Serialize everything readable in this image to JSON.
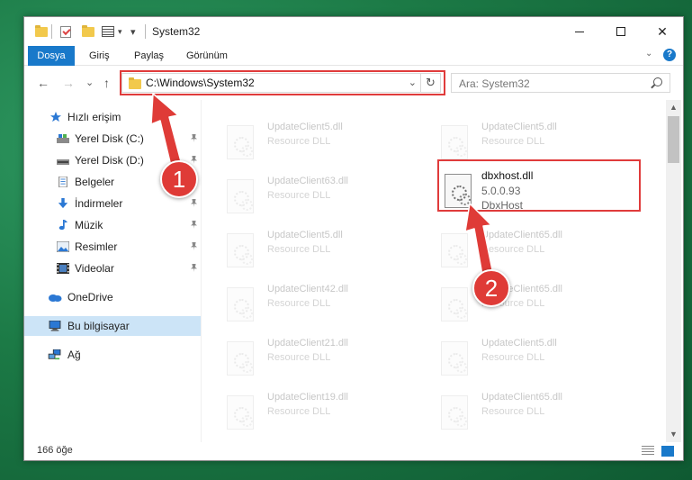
{
  "window": {
    "title": "System32"
  },
  "ribbon": {
    "tabs": [
      "Dosya",
      "Giriş",
      "Paylaş",
      "Görünüm"
    ],
    "active_tab": "Dosya",
    "expand": "⌄",
    "help": "?"
  },
  "nav": {
    "back": "←",
    "forward": "→",
    "recent": "⌄",
    "up": "↑"
  },
  "address": {
    "path": "C:\\Windows\\System32",
    "chevron": "⌄",
    "refresh": "↻"
  },
  "search": {
    "placeholder": "Ara: System32"
  },
  "sidebar": {
    "items": [
      {
        "label": "Hızlı erişim",
        "icon": "star-icon"
      },
      {
        "label": "Yerel Disk (C:)",
        "icon": "drive-c-icon",
        "pinned": true
      },
      {
        "label": "Yerel Disk (D:)",
        "icon": "drive-d-icon",
        "pinned": true
      },
      {
        "label": "Belgeler",
        "icon": "documents-icon",
        "pinned": true
      },
      {
        "label": "İndirmeler",
        "icon": "download-icon",
        "pinned": true
      },
      {
        "label": "Müzik",
        "icon": "music-icon",
        "pinned": true
      },
      {
        "label": "Resimler",
        "icon": "pictures-icon",
        "pinned": true
      },
      {
        "label": "Videolar",
        "icon": "videos-icon",
        "pinned": true
      },
      {
        "label": "OneDrive",
        "icon": "cloud-icon"
      },
      {
        "label": "Bu bilgisayar",
        "icon": "computer-icon",
        "selected": true
      },
      {
        "label": "Ağ",
        "icon": "network-icon"
      }
    ]
  },
  "files": [
    {
      "name": "UpdateClient5.dll",
      "desc": "Resource DLL"
    },
    {
      "name": "UpdateClient5.dll",
      "desc": "Resource DLL"
    },
    {
      "name": "UpdateClient63.dll",
      "desc": "Resource DLL"
    },
    {
      "name": "dbxhost.dll",
      "version": "5.0.0.93",
      "desc": "DbxHost"
    },
    {
      "name": "UpdateClient5.dll",
      "desc": "Resource DLL"
    },
    {
      "name": "UpdateClient65.dll",
      "desc": "Resource DLL"
    },
    {
      "name": "UpdateClient42.dll",
      "desc": "Resource DLL"
    },
    {
      "name": "UpdateClient65.dll",
      "desc": "Resource DLL"
    },
    {
      "name": "UpdateClient21.dll",
      "desc": "Resource DLL"
    },
    {
      "name": "UpdateClient5.dll",
      "desc": "Resource DLL"
    },
    {
      "name": "UpdateClient19.dll",
      "desc": "Resource DLL"
    },
    {
      "name": "UpdateClient65.dll",
      "desc": "Resource DLL"
    }
  ],
  "status": {
    "item_count": "166 öğe"
  },
  "callouts": [
    {
      "number": "1"
    },
    {
      "number": "2"
    }
  ],
  "colors": {
    "accent": "#1979ca",
    "highlight": "#e03b3b",
    "selected": "#cce4f7"
  }
}
